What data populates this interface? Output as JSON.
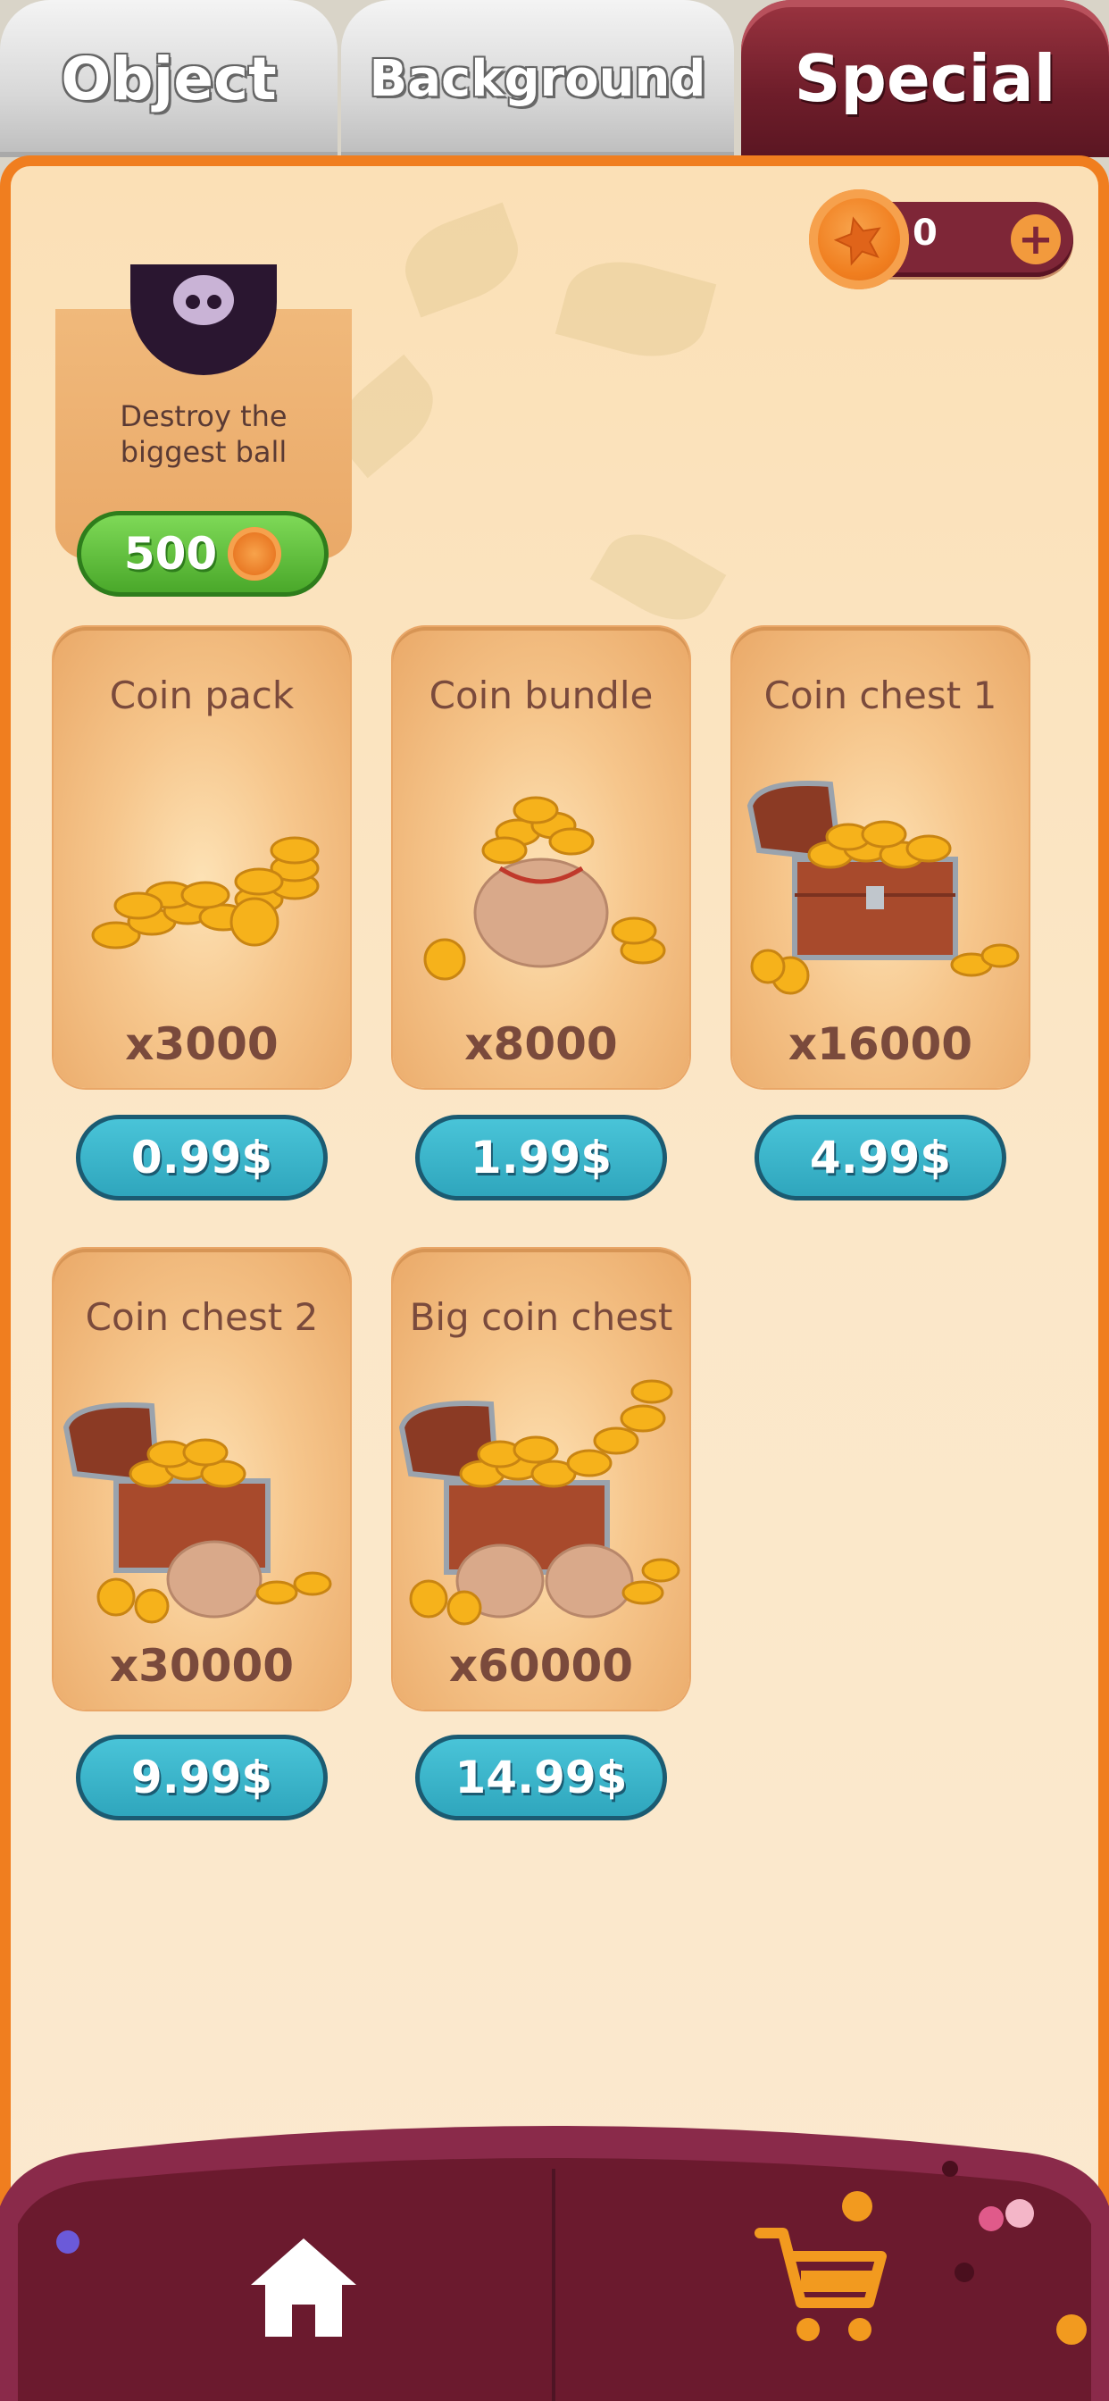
{
  "tabs": [
    {
      "label": "Object",
      "active": false
    },
    {
      "label": "Background",
      "active": false
    },
    {
      "label": "Special",
      "active": true
    }
  ],
  "coin_counter": {
    "value": "0",
    "icon": "coin-icon",
    "add_icon": "plus-icon"
  },
  "special_item": {
    "description_line1": "Destroy the",
    "description_line2": "biggest ball",
    "price": "500"
  },
  "packs": [
    {
      "title": "Coin pack",
      "quantity": "x3000",
      "price": "0.99$",
      "art": "coin-stack"
    },
    {
      "title": "Coin bundle",
      "quantity": "x8000",
      "price": "1.99$",
      "art": "coin-bag"
    },
    {
      "title": "Coin chest 1",
      "quantity": "x16000",
      "price": "4.99$",
      "art": "treasure-chest"
    },
    {
      "title": "Coin chest 2",
      "quantity": "x30000",
      "price": "9.99$",
      "art": "treasure-chest-bag"
    },
    {
      "title": "Big coin chest",
      "quantity": "x60000",
      "price": "14.99$",
      "art": "big-treasure-chest"
    }
  ],
  "nav": {
    "home_icon": "home-icon",
    "shop_icon": "cart-icon"
  },
  "colors": {
    "accent_orange": "#f07e1f",
    "tab_active": "#7e2637",
    "price_button": "#2fa6bd",
    "buy_button_green": "#4aa82a",
    "bottom_bar": "#6b1a2e",
    "text_brown": "#7a4a3c"
  }
}
